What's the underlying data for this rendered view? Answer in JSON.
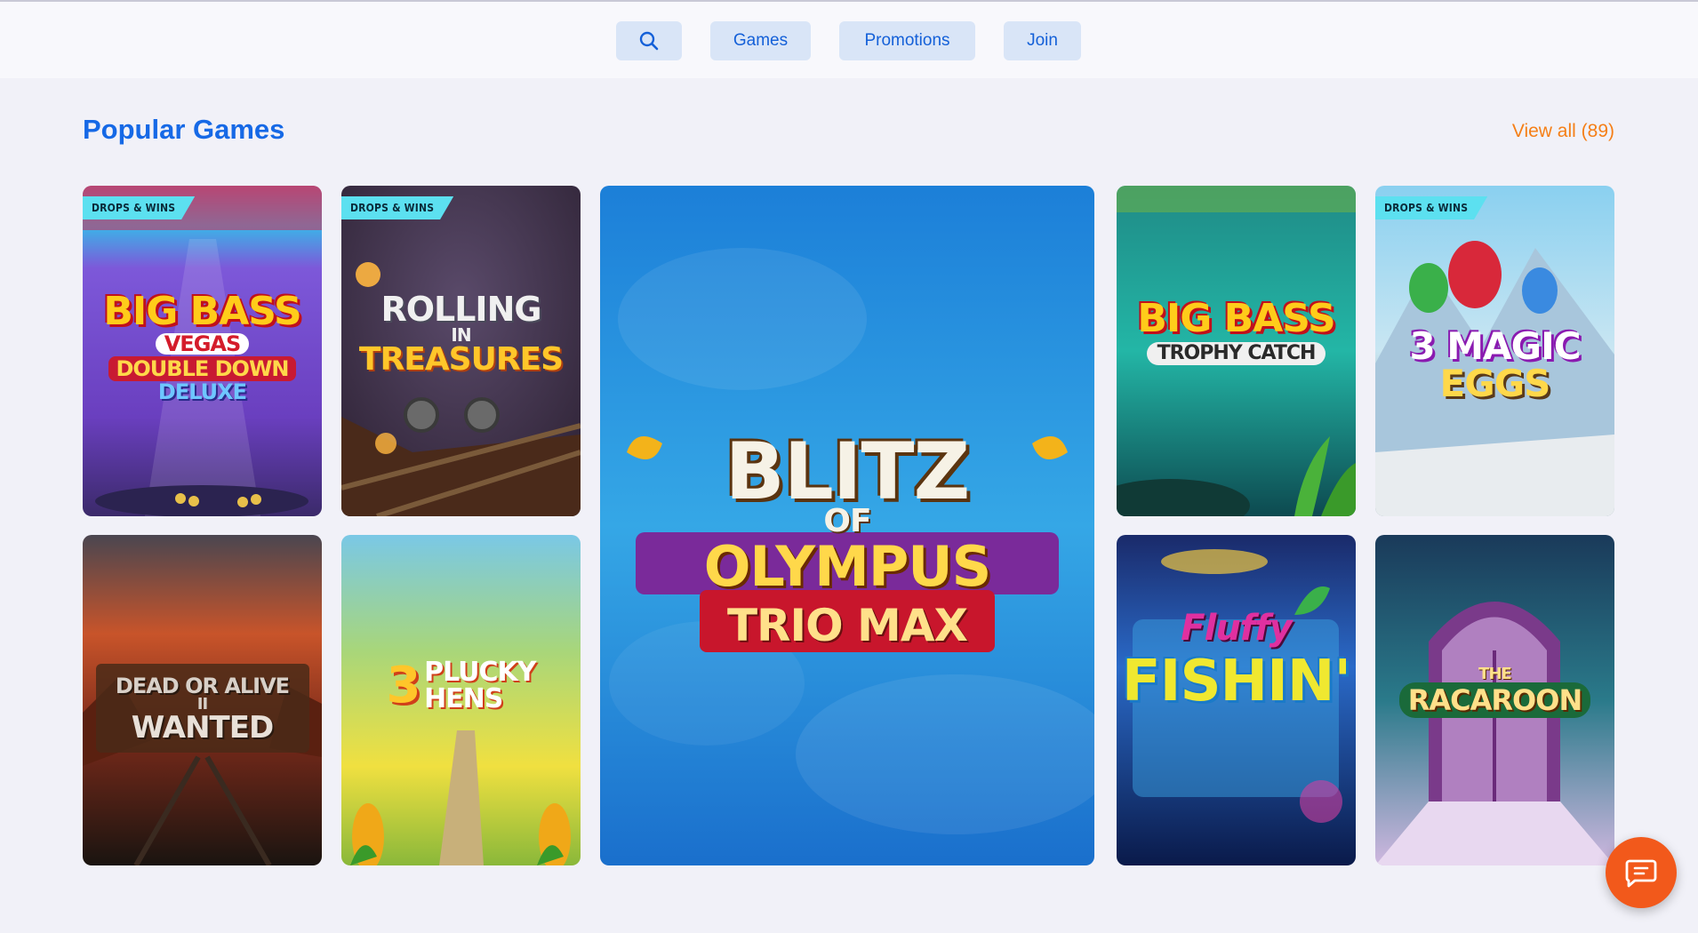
{
  "nav": {
    "search_icon": "search-icon",
    "games_label": "Games",
    "promotions_label": "Promotions",
    "join_label": "Join"
  },
  "section": {
    "title": "Popular Games",
    "view_all_label": "View all (89)"
  },
  "badge_text": "DROPS & WINS",
  "games": [
    {
      "id": "big-bass-vegas",
      "line1": "BIG BASS",
      "line2": "VEGAS",
      "line3": "DOUBLE DOWN",
      "line4": "DELUXE",
      "badge": true
    },
    {
      "id": "rolling-in-treasures",
      "line1": "ROLLING",
      "line2": "IN",
      "line3": "TREASURES",
      "badge": true
    },
    {
      "id": "blitz-of-olympus",
      "line1": "BLITZ",
      "line2": "OF",
      "line3": "OLYMPUS",
      "line4": "TRIO MAX",
      "badge": false
    },
    {
      "id": "big-bass-trophy-catch",
      "line1": "BIG BASS",
      "line2": "TROPHY CATCH",
      "badge": false
    },
    {
      "id": "3-magic-eggs",
      "line1": "3 MAGIC",
      "line2": "EGGS",
      "badge": true
    },
    {
      "id": "dead-or-alive-wanted",
      "line1": "DEAD OR ALIVE",
      "line2": "II",
      "line3": "WANTED",
      "badge": false
    },
    {
      "id": "3-plucky-hens",
      "line1": "3",
      "line2": "PLUCKY",
      "line3": "HENS",
      "badge": false
    },
    {
      "id": "fluffy-fishin",
      "line1": "Fluffy",
      "line2": "FISHIN'",
      "badge": false
    },
    {
      "id": "the-racaroon",
      "line1": "THE",
      "line2": "RACAROON",
      "badge": false
    }
  ],
  "chat": {
    "icon": "chat-bubble-icon"
  },
  "colors": {
    "accent_blue": "#1669e6",
    "accent_orange": "#f57f17",
    "chat_orange": "#f2591b",
    "badge_cyan": "#5ce0f0"
  }
}
